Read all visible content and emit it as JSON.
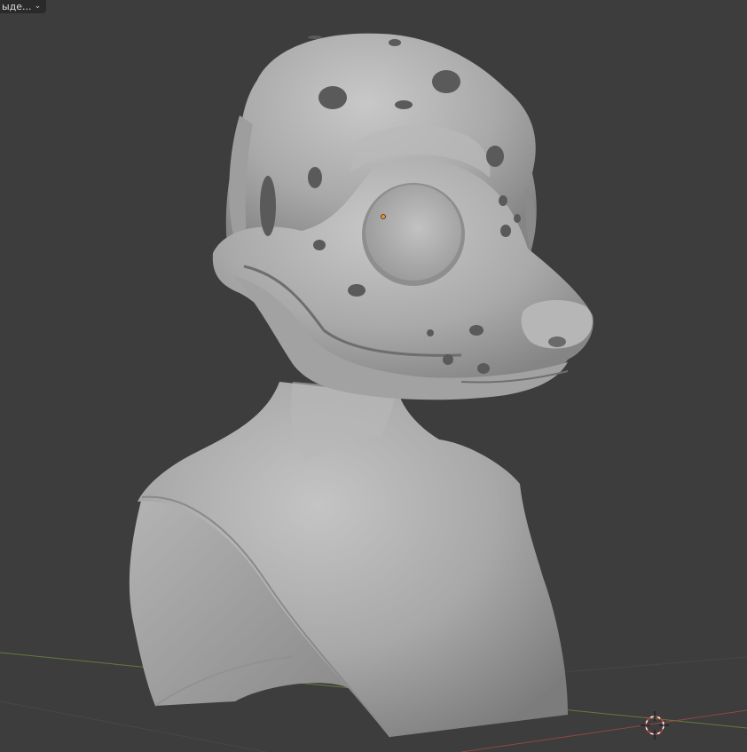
{
  "viewport": {
    "mode_dropdown": {
      "label": "ыде...",
      "icon": "chevron-down-icon"
    },
    "background_color": "#3d3d3d",
    "mesh_color": "#a9a9a9",
    "origin_color": "#ff8c1a",
    "axis_x_color": "#a84848",
    "axis_y_color": "#6c8a3e",
    "cursor_icon": "3d-cursor-icon"
  }
}
